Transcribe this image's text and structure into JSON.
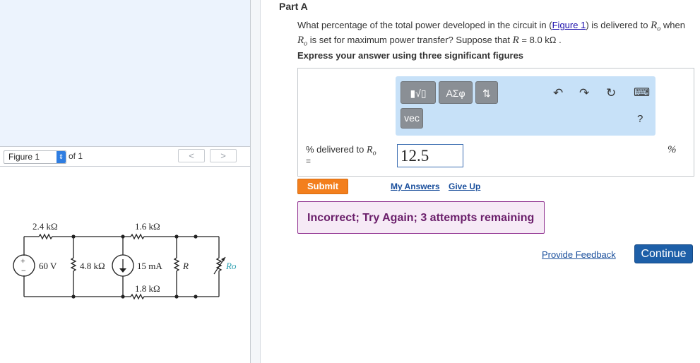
{
  "figure_nav": {
    "select_value": "Figure 1",
    "of_text": "of 1",
    "prev_label": "<",
    "next_label": ">"
  },
  "circuit": {
    "r1": "2.4 kΩ",
    "r2": "1.6 kΩ",
    "r3": "4.8 kΩ",
    "r4": "1.8 kΩ",
    "r_label": "R",
    "ro_label": "Ro",
    "source_v": "60 V",
    "source_i": "15 mA",
    "plus": "+",
    "minus": "−"
  },
  "part": {
    "title": "Part A",
    "q_before": "What percentage of the total power developed in the circuit in (",
    "q_link": "Figure 1",
    "q_middle": ") is delivered to ",
    "q_ro": "R",
    "q_ro_sub": "o",
    "q_when": " when",
    "q_line2_ro": "R",
    "q_line2_ro_sub": "o",
    "q_line2_text": " is set for maximum power transfer? Suppose that ",
    "q_r": "R",
    "q_r_value": " = 8.0 kΩ .",
    "express": "Express your answer using three significant figures"
  },
  "toolbar": {
    "templates_label": "▮√▯",
    "greek_label": "ΑΣφ",
    "arrows_label": "⇅",
    "vec_label": "vec",
    "undo_icon": "↶",
    "redo_icon": "↷",
    "reset_icon": "↻",
    "keyboard_icon": "⌨",
    "help_label": "?"
  },
  "answer": {
    "label_text": "% delivered to ",
    "label_var": "R",
    "label_sub": "o",
    "equals": "=",
    "value": "12.5",
    "unit": "%"
  },
  "actions": {
    "submit": "Submit",
    "my_answers": "My Answers",
    "give_up": "Give Up",
    "feedback": "Incorrect; Try Again; 3 attempts remaining",
    "provide_feedback": "Provide Feedback",
    "continue": "Continue"
  },
  "colors": {
    "submit": "#f37f1d",
    "continue": "#1d5fa8",
    "feedback_border": "#8e2e8e",
    "toolbar_bg": "#c7e1f8",
    "figure_panel_bg": "#ecf3fd"
  }
}
